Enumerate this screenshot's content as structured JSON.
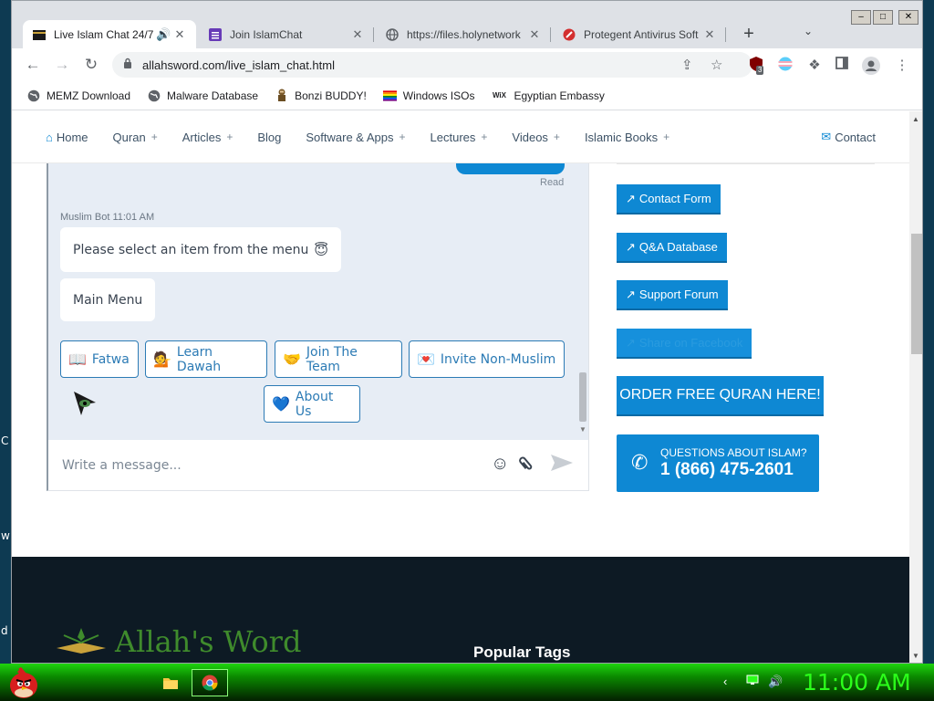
{
  "desktop": {
    "edge_letters": [
      "C",
      "w",
      "d"
    ]
  },
  "browser": {
    "tabs": [
      {
        "title": "Live Islam Chat 24/7",
        "icon": "kaaba-favicon",
        "active": true,
        "audio": true
      },
      {
        "title": "Join IslamChat",
        "icon": "form-favicon"
      },
      {
        "title": "https://files.holynetwork",
        "icon": "globe-favicon"
      },
      {
        "title": "Protegent Antivirus Soft",
        "icon": "protegent-favicon"
      }
    ],
    "new_tab_label": "+",
    "window_buttons": [
      "‒",
      "□",
      "✕"
    ],
    "url": "allahsword.com/live_islam_chat.html",
    "extension_badge": "3",
    "bookmarks": [
      {
        "label": "MEMZ Download",
        "icon": "globe-icon"
      },
      {
        "label": "Malware Database",
        "icon": "globe-icon"
      },
      {
        "label": "Bonzi BUDDY!",
        "icon": "bonzi-icon"
      },
      {
        "label": "Windows ISOs",
        "icon": "rainbow-flag-icon"
      },
      {
        "label": "Egyptian Embassy",
        "icon": "wix-icon",
        "icon_text": "WiX"
      }
    ]
  },
  "site": {
    "nav": [
      {
        "label": "Home",
        "plus": false
      },
      {
        "label": "Quran",
        "plus": true
      },
      {
        "label": "Articles",
        "plus": true
      },
      {
        "label": "Blog",
        "plus": false
      },
      {
        "label": "Software & Apps",
        "plus": true
      },
      {
        "label": "Lectures",
        "plus": true
      },
      {
        "label": "Videos",
        "plus": true
      },
      {
        "label": "Islamic Books",
        "plus": true
      }
    ],
    "nav_plus": "+",
    "contact": "Contact",
    "chat": {
      "read_label": "Read",
      "bot_meta": "Muslim Bot 11:01 AM",
      "messages": [
        "Please select an item from the menu",
        "Main Menu"
      ],
      "message_emoji": "😇",
      "quick_replies": [
        {
          "label": "Fatwa",
          "emoji": "📖"
        },
        {
          "label": "Learn Dawah",
          "emoji": "💁"
        },
        {
          "label": "Join The Team",
          "emoji": "🤝"
        },
        {
          "label": "Invite Non-Muslim",
          "emoji": "💌"
        },
        {
          "label": "About Us",
          "emoji": "💙"
        }
      ],
      "input_placeholder": "Write a message..."
    },
    "sidebar": {
      "buttons": [
        "Contact Form",
        "Q&A Database",
        "Support Forum",
        "Share on Facebook"
      ],
      "order_label": "ORDER FREE QURAN HERE!",
      "phone_question": "QUESTIONS ABOUT ISLAM?",
      "phone_number": "1 (866) 475-2601"
    },
    "footer": {
      "logo_text": "Allah's Word",
      "popular_tags": "Popular Tags"
    }
  },
  "taskbar": {
    "clock": "11:00 AM"
  },
  "colors": {
    "accent": "#0e88d3",
    "chat_bg": "#e7edf5",
    "footer_bg": "#0d1a24",
    "taskbar_green": "#1fd40f"
  }
}
